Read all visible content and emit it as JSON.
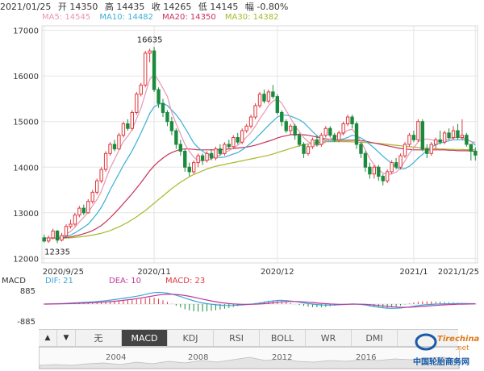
{
  "info": {
    "date": "2021/01/25",
    "open": "开 14350",
    "high": "高 14435",
    "close": "收 14265",
    "low": "低 14145",
    "change": "幅 -0.80%"
  },
  "ma": [
    {
      "label": "MA5: 14545",
      "color": "#e896b4"
    },
    {
      "label": "MA10: 14482",
      "color": "#3ab0d6"
    },
    {
      "label": "MA20: 14350",
      "color": "#c8315a"
    },
    {
      "label": "MA30: 14382",
      "color": "#a8b82a"
    }
  ],
  "colors": {
    "up": "#e0393e",
    "down": "#1b8a3c",
    "grid": "#e6e6e6",
    "dif": "#3aa6d6",
    "dea": "#c03a9a"
  },
  "chart_data": {
    "type": "candlestick",
    "ylim": [
      11900,
      17100
    ],
    "yticks": [
      "12000",
      "13000",
      "14000",
      "15000",
      "16000",
      "17000"
    ],
    "xlabels": [
      {
        "label": "2020/9/25",
        "i": 0
      },
      {
        "label": "2020/11",
        "i": 25
      },
      {
        "label": "2020/12",
        "i": 53
      },
      {
        "label": "2021/1",
        "i": 84
      },
      {
        "label": "2021/1/25",
        "i": 98
      }
    ],
    "annotations": [
      {
        "label": "16635",
        "i": 24,
        "value": 16635,
        "pos": "above"
      },
      {
        "label": "12335",
        "i": 3,
        "value": 12335,
        "pos": "below"
      }
    ],
    "candles": [
      [
        12450,
        12380,
        12520,
        12350
      ],
      [
        12380,
        12450,
        12500,
        12340
      ],
      [
        12450,
        12600,
        12650,
        12420
      ],
      [
        12600,
        12400,
        12620,
        12335
      ],
      [
        12400,
        12500,
        12560,
        12370
      ],
      [
        12500,
        12700,
        12750,
        12480
      ],
      [
        12700,
        12750,
        12850,
        12650
      ],
      [
        12750,
        12950,
        13000,
        12700
      ],
      [
        12950,
        13100,
        13150,
        12900
      ],
      [
        13100,
        13000,
        13180,
        12950
      ],
      [
        13000,
        13250,
        13300,
        12980
      ],
      [
        13250,
        13450,
        13500,
        13200
      ],
      [
        13450,
        13700,
        13750,
        13400
      ],
      [
        13700,
        13950,
        14000,
        13650
      ],
      [
        13950,
        14300,
        14350,
        13900
      ],
      [
        14300,
        14500,
        14550,
        14250
      ],
      [
        14500,
        14400,
        14600,
        14350
      ],
      [
        14400,
        14700,
        14750,
        14380
      ],
      [
        14700,
        14950,
        15000,
        14650
      ],
      [
        14950,
        14850,
        15050,
        14800
      ],
      [
        14850,
        15200,
        15250,
        14800
      ],
      [
        15200,
        15600,
        15650,
        15150
      ],
      [
        15600,
        15800,
        15850,
        15550
      ],
      [
        15800,
        16500,
        16550,
        15750
      ],
      [
        16500,
        16550,
        16600,
        16300
      ],
      [
        16550,
        15700,
        16635,
        15650
      ],
      [
        15700,
        15400,
        15750,
        15300
      ],
      [
        15400,
        15200,
        15500,
        15100
      ],
      [
        15200,
        15000,
        15250,
        14900
      ],
      [
        15000,
        14800,
        15100,
        14700
      ],
      [
        14800,
        14500,
        14850,
        14400
      ],
      [
        14500,
        14350,
        14600,
        14250
      ],
      [
        14350,
        14000,
        14400,
        13900
      ],
      [
        14000,
        13900,
        14100,
        13800
      ],
      [
        13900,
        14100,
        14150,
        13850
      ],
      [
        14100,
        14250,
        14300,
        14000
      ],
      [
        14250,
        14150,
        14300,
        14050
      ],
      [
        14150,
        14300,
        14350,
        14100
      ],
      [
        14300,
        14200,
        14400,
        14150
      ],
      [
        14200,
        14400,
        14450,
        14150
      ],
      [
        14400,
        14300,
        14500,
        14250
      ],
      [
        14300,
        14500,
        14550,
        14250
      ],
      [
        14500,
        14450,
        14600,
        14400
      ],
      [
        14450,
        14650,
        14700,
        14400
      ],
      [
        14650,
        14550,
        14750,
        14500
      ],
      [
        14550,
        14800,
        14850,
        14500
      ],
      [
        14800,
        14900,
        14950,
        14750
      ],
      [
        14900,
        15100,
        15150,
        14850
      ],
      [
        15100,
        15350,
        15400,
        15050
      ],
      [
        15350,
        15600,
        15650,
        15300
      ],
      [
        15600,
        15450,
        15700,
        15400
      ],
      [
        15450,
        15650,
        15700,
        15400
      ],
      [
        15650,
        15550,
        15800,
        15500
      ],
      [
        15550,
        15200,
        15600,
        15150
      ],
      [
        15200,
        15000,
        15250,
        14900
      ],
      [
        15000,
        14800,
        15050,
        14750
      ],
      [
        14800,
        14900,
        14950,
        14700
      ],
      [
        14900,
        14700,
        14950,
        14600
      ],
      [
        14700,
        14500,
        14750,
        14450
      ],
      [
        14500,
        14300,
        14550,
        14200
      ],
      [
        14300,
        14450,
        14500,
        14250
      ],
      [
        14450,
        14600,
        14650,
        14400
      ],
      [
        14600,
        14500,
        14700,
        14450
      ],
      [
        14500,
        14700,
        14750,
        14450
      ],
      [
        14700,
        14850,
        14900,
        14650
      ],
      [
        14850,
        14700,
        14900,
        14650
      ],
      [
        14700,
        14600,
        14750,
        14550
      ],
      [
        14600,
        14750,
        14800,
        14550
      ],
      [
        14750,
        14950,
        15000,
        14700
      ],
      [
        14950,
        15100,
        15150,
        14900
      ],
      [
        15100,
        14950,
        15150,
        14850
      ],
      [
        14950,
        14500,
        15000,
        14400
      ],
      [
        14500,
        14300,
        14550,
        14200
      ],
      [
        14300,
        14000,
        14350,
        13900
      ],
      [
        14000,
        13850,
        14100,
        13750
      ],
      [
        13850,
        14000,
        14050,
        13750
      ],
      [
        14000,
        13800,
        14050,
        13700
      ],
      [
        13800,
        13700,
        13850,
        13600
      ],
      [
        13700,
        13900,
        13950,
        13650
      ],
      [
        13900,
        14100,
        14150,
        13850
      ],
      [
        14100,
        14000,
        14200,
        13950
      ],
      [
        14000,
        14250,
        14300,
        13950
      ],
      [
        14250,
        14500,
        14550,
        14200
      ],
      [
        14500,
        14700,
        14750,
        14450
      ],
      [
        14700,
        14600,
        14800,
        14550
      ],
      [
        14600,
        15000,
        15050,
        14550
      ],
      [
        15000,
        14400,
        15050,
        14350
      ],
      [
        14400,
        14300,
        14500,
        14200
      ],
      [
        14300,
        14500,
        14550,
        14250
      ],
      [
        14500,
        14600,
        14650,
        14400
      ],
      [
        14600,
        14550,
        14800,
        14500
      ],
      [
        14550,
        14750,
        14800,
        14500
      ],
      [
        14750,
        14650,
        14850,
        14600
      ],
      [
        14650,
        14800,
        14900,
        14600
      ],
      [
        14800,
        14650,
        14950,
        14600
      ],
      [
        14650,
        14700,
        15050,
        14600
      ],
      [
        14700,
        14500,
        14750,
        14450
      ],
      [
        14500,
        14350,
        14435,
        14145
      ],
      [
        14350,
        14265,
        14435,
        14145
      ]
    ],
    "ma5": [
      12450,
      12430,
      12440,
      12460,
      12470,
      12530,
      12590,
      12680,
      12800,
      12900,
      13010,
      13150,
      13290,
      13470,
      13730,
      13980,
      14170,
      14370,
      14560,
      14680,
      14820,
      15060,
      15290,
      15610,
      15930,
      16030,
      15900,
      15730,
      15550,
      15200,
      14950,
      14730,
      14500,
      14350,
      14220,
      14140,
      14140,
      14150,
      14180,
      14240,
      14270,
      14320,
      14360,
      14420,
      14480,
      14560,
      14660,
      14760,
      14900,
      15060,
      15200,
      15350,
      15450,
      15500,
      15400,
      15240,
      15080,
      14900,
      14780,
      14650,
      14560,
      14500,
      14480,
      14500,
      14550,
      14620,
      14660,
      14700,
      14740,
      14810,
      14830,
      14720,
      14560,
      14380,
      14190,
      14050,
      13950,
      13870,
      13840,
      13850,
      13890,
      13980,
      14140,
      14300,
      14420,
      14560,
      14600,
      14620,
      14600,
      14580,
      14560,
      14600,
      14620,
      14640,
      14660,
      14640,
      14620,
      14560,
      14545
    ],
    "ma10": [
      12450,
      12440,
      12440,
      12450,
      12460,
      12480,
      12510,
      12560,
      12620,
      12680,
      12750,
      12860,
      12980,
      13120,
      13300,
      13500,
      13680,
      13860,
      14040,
      14200,
      14360,
      14550,
      14750,
      14960,
      15180,
      15320,
      15380,
      15400,
      15350,
      15250,
      15150,
      15020,
      14860,
      14700,
      14530,
      14430,
      14350,
      14290,
      14250,
      14230,
      14210,
      14220,
      14250,
      14290,
      14320,
      14380,
      14450,
      14530,
      14620,
      14720,
      14820,
      14920,
      15010,
      15100,
      15140,
      15140,
      15120,
      15080,
      15040,
      14980,
      14880,
      14780,
      14690,
      14620,
      14580,
      14570,
      14580,
      14590,
      14620,
      14650,
      14700,
      14680,
      14640,
      14580,
      14500,
      14420,
      14330,
      14240,
      14160,
      14080,
      14000,
      13960,
      13970,
      14020,
      14100,
      14200,
      14280,
      14380,
      14440,
      14490,
      14530,
      14550,
      14580,
      14600,
      14600,
      14600,
      14590,
      14570,
      14482
    ],
    "ma20": [
      12450,
      12440,
      12440,
      12445,
      12450,
      12460,
      12470,
      12490,
      12510,
      12540,
      12570,
      12610,
      12660,
      12720,
      12800,
      12890,
      12990,
      13090,
      13200,
      13310,
      13420,
      13540,
      13660,
      13790,
      13920,
      14030,
      14120,
      14200,
      14270,
      14320,
      14360,
      14390,
      14400,
      14400,
      14390,
      14380,
      14380,
      14380,
      14380,
      14380,
      14380,
      14390,
      14400,
      14410,
      14420,
      14430,
      14440,
      14460,
      14480,
      14510,
      14540,
      14570,
      14600,
      14640,
      14670,
      14690,
      14710,
      14720,
      14720,
      14710,
      14700,
      14680,
      14660,
      14640,
      14620,
      14610,
      14600,
      14590,
      14590,
      14590,
      14590,
      14590,
      14580,
      14570,
      14550,
      14530,
      14510,
      14490,
      14470,
      14450,
      14430,
      14410,
      14400,
      14390,
      14380,
      14380,
      14380,
      14380,
      14380,
      14380,
      14380,
      14380,
      14370,
      14370,
      14360,
      14360,
      14360,
      14355,
      14350
    ],
    "ma30": [
      12450,
      12445,
      12440,
      12440,
      12440,
      12445,
      12450,
      12460,
      12470,
      12480,
      12495,
      12510,
      12530,
      12550,
      12580,
      12610,
      12650,
      12690,
      12740,
      12790,
      12850,
      12910,
      12980,
      13050,
      13130,
      13210,
      13290,
      13370,
      13450,
      13530,
      13600,
      13670,
      13730,
      13790,
      13840,
      13880,
      13920,
      13960,
      13990,
      14020,
      14040,
      14060,
      14080,
      14100,
      14120,
      14140,
      14160,
      14180,
      14200,
      14220,
      14240,
      14260,
      14290,
      14320,
      14350,
      14380,
      14410,
      14440,
      14470,
      14490,
      14510,
      14530,
      14540,
      14550,
      14560,
      14560,
      14560,
      14560,
      14560,
      14560,
      14555,
      14550,
      14545,
      14540,
      14535,
      14530,
      14520,
      14510,
      14500,
      14490,
      14480,
      14470,
      14460,
      14450,
      14440,
      14430,
      14420,
      14415,
      14410,
      14405,
      14400,
      14395,
      14392,
      14390,
      14388,
      14386,
      14384,
      14383,
      14382
    ]
  },
  "macd": {
    "label": "MACD",
    "dif_label": "DIF: 21",
    "dea_label": "DEA: 10",
    "macd_label": "MACD: 23",
    "max_label": "885",
    "min_label": "-885",
    "range": [
      -885,
      885
    ],
    "dif": [
      0,
      5,
      12,
      20,
      28,
      38,
      50,
      62,
      75,
      88,
      100,
      115,
      130,
      150,
      175,
      205,
      235,
      265,
      300,
      335,
      370,
      410,
      450,
      500,
      560,
      600,
      610,
      600,
      570,
      520,
      460,
      390,
      310,
      240,
      170,
      110,
      60,
      20,
      -10,
      -40,
      -60,
      -70,
      -75,
      -70,
      -60,
      -45,
      -25,
      -5,
      20,
      50,
      90,
      130,
      165,
      190,
      195,
      180,
      160,
      130,
      100,
      65,
      30,
      0,
      -25,
      -45,
      -55,
      -55,
      -50,
      -40,
      -25,
      -10,
      5,
      0,
      -20,
      -50,
      -90,
      -130,
      -165,
      -195,
      -215,
      -225,
      -220,
      -205,
      -180,
      -150,
      -115,
      -80,
      -50,
      -30,
      -15,
      -5,
      5,
      12,
      18,
      22,
      25,
      26,
      25,
      23,
      21
    ],
    "dea": [
      0,
      2,
      5,
      9,
      14,
      19,
      26,
      33,
      41,
      50,
      60,
      70,
      82,
      95,
      110,
      128,
      148,
      170,
      195,
      222,
      250,
      282,
      316,
      353,
      395,
      436,
      471,
      497,
      512,
      513,
      502,
      479,
      445,
      404,
      357,
      308,
      258,
      210,
      164,
      121,
      84,
      53,
      27,
      7,
      -6,
      -14,
      -16,
      -14,
      -7,
      4,
      21,
      43,
      67,
      92,
      113,
      127,
      133,
      133,
      126,
      115,
      98,
      79,
      59,
      38,
      20,
      5,
      -6,
      -13,
      -15,
      -14,
      -10,
      -8,
      -10,
      -18,
      -32,
      -51,
      -74,
      -98,
      -121,
      -142,
      -158,
      -167,
      -170,
      -166,
      -156,
      -141,
      -123,
      -104,
      -86,
      -70,
      -55,
      -41,
      -29,
      -19,
      -10,
      -3,
      2,
      6,
      10
    ]
  },
  "tabs": {
    "up_arrow": "▲",
    "down_arrow": "▼",
    "items": [
      "无",
      "MACD",
      "KDJ",
      "RSI",
      "BOLL",
      "WR",
      "DMI"
    ],
    "active": 1
  },
  "navigator": {
    "years": [
      "2004",
      "2008",
      "2012",
      "2016"
    ]
  },
  "watermark": {
    "logo_text": "Tirechina",
    "logo_sub": ".net",
    "caption": "中国轮胎商务网"
  }
}
